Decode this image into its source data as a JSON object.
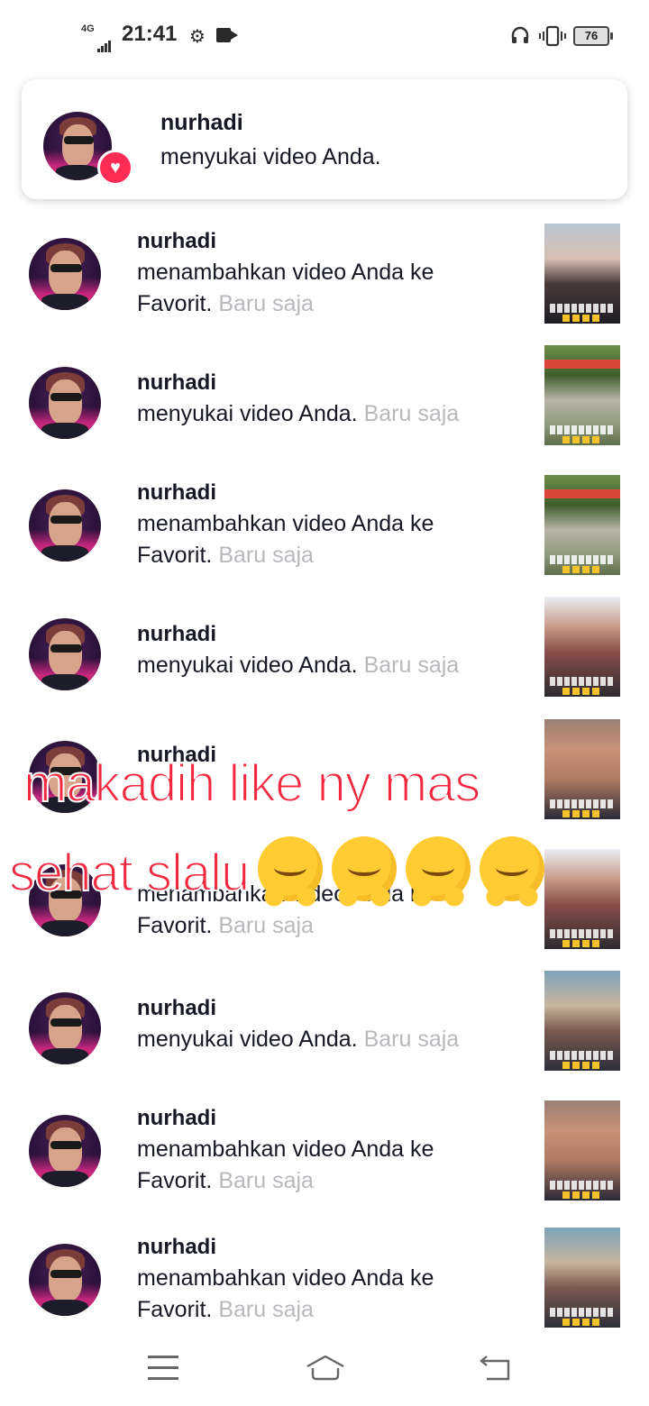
{
  "status_bar": {
    "network": "4G",
    "time": "21:41",
    "battery": "76"
  },
  "banner": {
    "username": "nurhadi",
    "message": "menyukai video Anda."
  },
  "notifications": [
    {
      "username": "nurhadi",
      "message": "menambahkan video Anda ke Favorit.",
      "time": "Baru saja"
    },
    {
      "username": "nurhadi",
      "message": "menyukai video Anda.",
      "time": "Baru saja"
    },
    {
      "username": "nurhadi",
      "message": "menambahkan video Anda ke Favorit.",
      "time": "Baru saja"
    },
    {
      "username": "nurhadi",
      "message": "menyukai video Anda.",
      "time": "Baru saja"
    },
    {
      "username": "nurhadi",
      "message": "",
      "time": ""
    },
    {
      "username": "",
      "message": "menambahkan video Anda ke Favorit.",
      "time": "Baru saja"
    },
    {
      "username": "nurhadi",
      "message": "menyukai video Anda.",
      "time": "Baru saja"
    },
    {
      "username": "nurhadi",
      "message": "menambahkan video Anda ke Favorit.",
      "time": "Baru saja"
    },
    {
      "username": "nurhadi",
      "message": "menambahkan video Anda ke Favorit.",
      "time": "Baru saja"
    }
  ],
  "overlay": {
    "line1": "makadih like ny mas",
    "line2": "sehat slalu"
  },
  "colors": {
    "accent": "#fe2c55",
    "overlay_text": "#f2283f",
    "muted": "#b8b8bd"
  },
  "icons": [
    "settings-gear-icon",
    "video-camera-icon",
    "headphones-icon",
    "vibrate-icon",
    "battery-icon",
    "heart-icon",
    "hug-emoji-icon",
    "menu-icon",
    "home-icon",
    "back-icon"
  ]
}
